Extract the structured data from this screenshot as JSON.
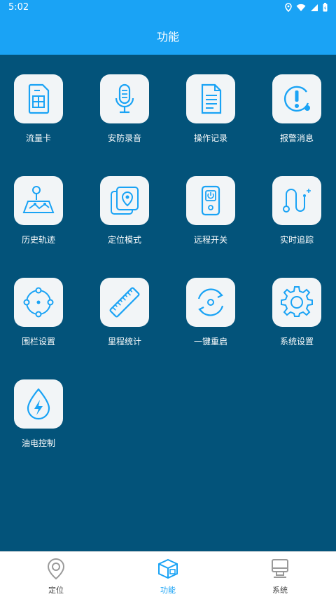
{
  "status_bar": {
    "time": "5:02"
  },
  "app_bar": {
    "title": "功能"
  },
  "functions": [
    {
      "label": "流量卡",
      "icon": "sim-card-icon"
    },
    {
      "label": "安防录音",
      "icon": "microphone-icon"
    },
    {
      "label": "操作记录",
      "icon": "document-icon"
    },
    {
      "label": "报警消息",
      "icon": "alert-icon"
    },
    {
      "label": "历史轨迹",
      "icon": "map-route-icon"
    },
    {
      "label": "定位模式",
      "icon": "location-cards-icon"
    },
    {
      "label": "远程开关",
      "icon": "remote-power-icon"
    },
    {
      "label": "实时追踪",
      "icon": "tracking-path-icon"
    },
    {
      "label": "围栏设置",
      "icon": "fence-crosshair-icon"
    },
    {
      "label": "里程统计",
      "icon": "ruler-icon"
    },
    {
      "label": "一键重启",
      "icon": "restart-icon"
    },
    {
      "label": "系统设置",
      "icon": "gear-icon"
    },
    {
      "label": "油电控制",
      "icon": "oil-drop-bolt-icon"
    }
  ],
  "tabs": [
    {
      "label": "定位",
      "icon": "location-pin-icon",
      "active": false
    },
    {
      "label": "功能",
      "icon": "cube-box-icon",
      "active": true
    },
    {
      "label": "系统",
      "icon": "monitor-icon",
      "active": false
    }
  ],
  "colors": {
    "accent": "#1aa3f5",
    "panel": "#03537a",
    "tile": "#f2f5f7"
  }
}
